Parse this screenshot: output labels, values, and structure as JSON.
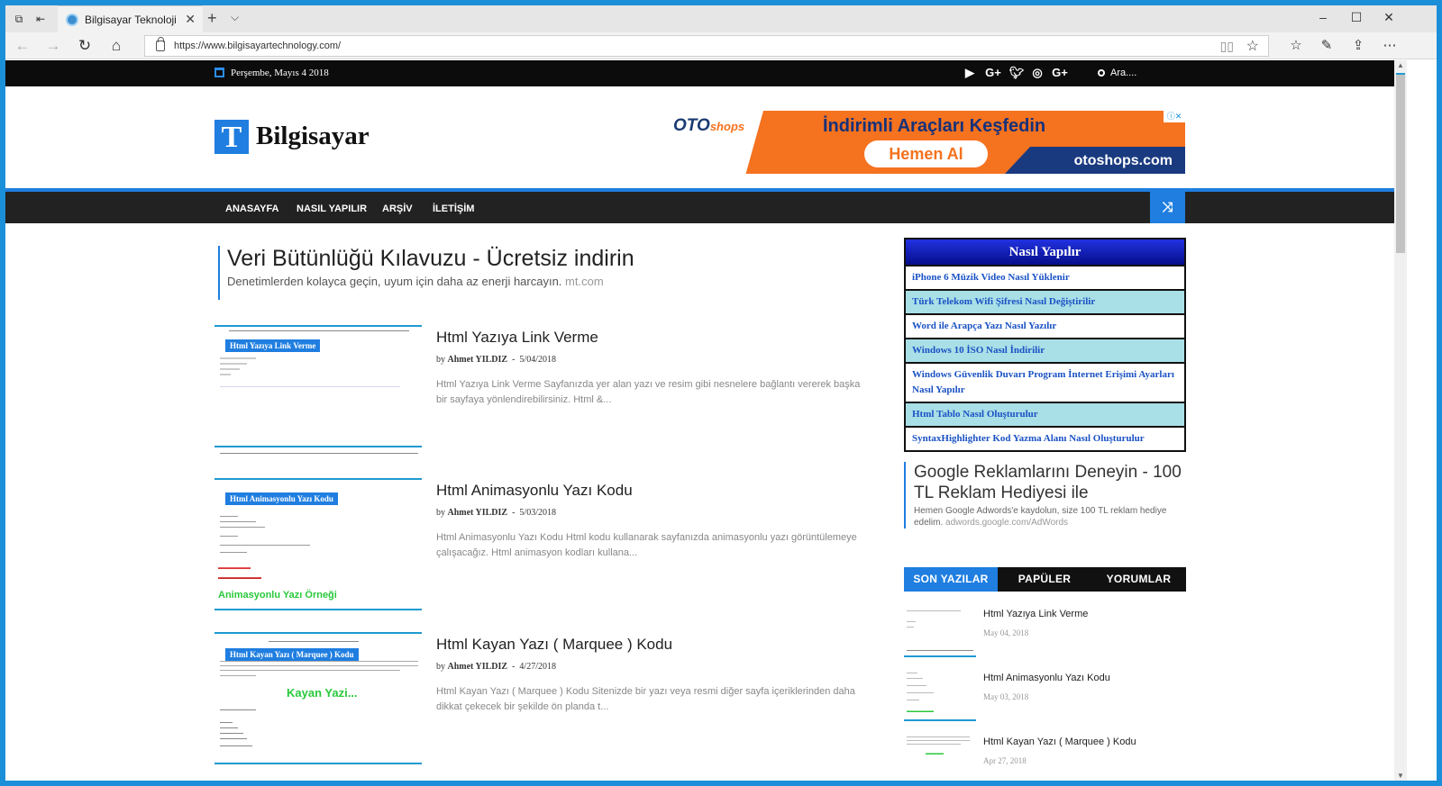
{
  "browser": {
    "tab_title": "Bilgisayar Teknoloji",
    "url": "https://www.bilgisayartechnology.com/"
  },
  "topbar": {
    "date": "Perşembe, Mayıs 4 2018",
    "search_placeholder": "Ara....",
    "social": [
      "youtube-icon",
      "google-plus-icon",
      "twitter-icon",
      "instagram-icon",
      "google-plus-icon"
    ]
  },
  "header": {
    "logo_letter": "T",
    "logo_text": "Bilgisayar",
    "ad": {
      "brand": "OTO",
      "brand_suffix": "shops",
      "headline": "İndirimli Araçları Keşfedin",
      "button": "Hemen Al",
      "site": "otoshops.com"
    }
  },
  "nav": {
    "items": [
      "ANASAYFA",
      "NASIL YAPILIR",
      "ARŞİV",
      "İLETİŞİM"
    ]
  },
  "main_ad": {
    "headline": "Veri Bütünlüğü Kılavuzu - Ücretsiz indirin",
    "description": "Denetimlerden kolayca geçin, uyum için daha az enerji harcayın.",
    "domain": "mt.com"
  },
  "posts": [
    {
      "title": "Html Yazıya Link Verme",
      "author": "Ahmet YILDIZ",
      "date": "5/04/2018",
      "thumb_tag": "Html Yazıya Link Verme",
      "excerpt": "Html Yazıya Link Verme Sayfanızda yer alan yazı ve resim gibi nesnelere bağlantı vererek başka bir sayfaya yönlendirebilirsiniz. Html &..."
    },
    {
      "title": "Html Animasyonlu Yazı Kodu",
      "author": "Ahmet YILDIZ",
      "date": "5/03/2018",
      "thumb_tag": "Html Animasyonlu Yazı Kodu",
      "thumb_green": "Animasyonlu Yazı Örneği",
      "excerpt": "Html Animasyonlu Yazı Kodu Html kodu kullanarak sayfanızda animasyonlu yazı görüntülemeye çalışacağız. Html animasyon kodları kullana..."
    },
    {
      "title": "Html Kayan Yazı ( Marquee ) Kodu",
      "author": "Ahmet YILDIZ",
      "date": "4/27/2018",
      "thumb_tag": "Html Kayan Yazı ( Marquee ) Kodu",
      "thumb_green": "Kayan Yazi...",
      "excerpt": "Html Kayan Yazı ( Marquee ) Kodu Sitenizde bir yazı veya resmi diğer sayfa içeriklerinden daha dikkat çekecek bir şekilde ön planda t..."
    }
  ],
  "sidebar": {
    "howto_title": "Nasıl Yapılır",
    "howto_links": [
      "iPhone 6 Müzik Video Nasıl Yüklenir",
      "Türk Telekom Wifi Şifresi Nasıl Değiştirilir",
      "Word ile Arapça Yazı Nasıl Yazılır",
      "Windows 10 İSO Nasıl İndirilir",
      "Windows Güvenlik Duvarı Program İnternet Erişimi Ayarları Nasıl Yapılır",
      "Html Tablo Nasıl Oluşturulur",
      "SyntaxHighlighter Kod Yazma Alanı Nasıl Oluşturulur"
    ],
    "ad": {
      "headline": "Google Reklamlarını Deneyin - 100 TL Reklam Hediyesi ile",
      "description": "Hemen Google Adwords'e kaydolun, size 100 TL reklam hediye edelim.",
      "domain": "adwords.google.com/AdWords"
    },
    "tabs": [
      "SON YAZILAR",
      "PAPÜLER",
      "YORUMLAR"
    ],
    "recent": [
      {
        "title": "Html Yazıya Link Verme",
        "date": "May 04, 2018"
      },
      {
        "title": "Html Animasyonlu Yazı Kodu",
        "date": "May 03, 2018"
      },
      {
        "title": "Html Kayan Yazı ( Marquee ) Kodu",
        "date": "Apr 27, 2018"
      }
    ]
  }
}
